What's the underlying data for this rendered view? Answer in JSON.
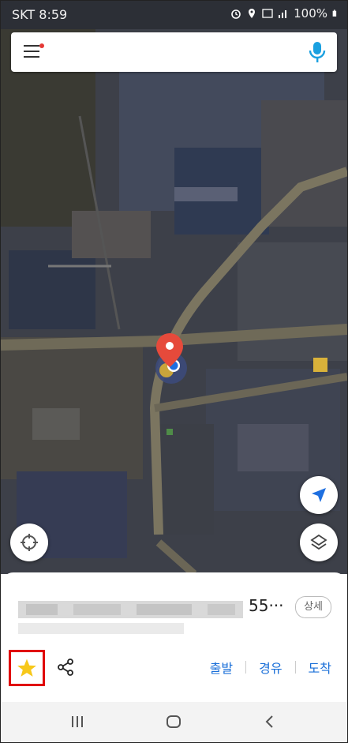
{
  "status_bar": {
    "carrier_time": "SKT 8:59",
    "battery": "100%"
  },
  "search": {
    "placeholder": ""
  },
  "place": {
    "address_visible_end": "55···",
    "detail_label": "상세"
  },
  "actions": {
    "depart": "출발",
    "via": "경유",
    "arrive": "도착"
  },
  "colors": {
    "accent": "#1a6fd8",
    "favorite_star": "#f7c81a",
    "highlight": "#e00000",
    "pin": "#e64a3b"
  },
  "icons": {
    "menu": "hamburger-icon",
    "mic": "microphone-icon",
    "locate": "crosshair-icon",
    "navigate": "navigation-arrow-icon",
    "layers": "layers-icon",
    "favorite": "star-icon",
    "share": "share-icon"
  }
}
